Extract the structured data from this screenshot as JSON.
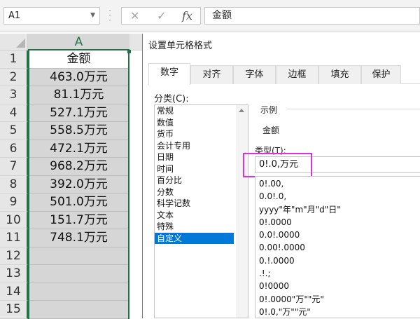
{
  "formula_bar": {
    "name_box": "A1",
    "cancel_icon": "✕",
    "enter_icon": "✓",
    "fx_label": "fx",
    "content": "金额"
  },
  "sheet": {
    "column_header": "A",
    "row_numbers": [
      "1",
      "2",
      "3",
      "4",
      "5",
      "6",
      "7",
      "8",
      "9",
      "10",
      "11",
      "12",
      "13",
      "14",
      "15"
    ],
    "cells": [
      "金额",
      "463.0万元",
      "81.1万元",
      "527.1万元",
      "558.5万元",
      "472.1万元",
      "968.2万元",
      "392.0万元",
      "501.0万元",
      "151.7万元",
      "748.1万元",
      "",
      "",
      "",
      ""
    ]
  },
  "dialog": {
    "title": "设置单元格格式",
    "tabs": [
      "数字",
      "对齐",
      "字体",
      "边框",
      "填充",
      "保护"
    ],
    "active_tab": "数字",
    "category_label": "分类(C):",
    "categories": [
      "常规",
      "数值",
      "货币",
      "会计专用",
      "日期",
      "时间",
      "百分比",
      "分数",
      "科学记数",
      "文本",
      "特殊",
      "自定义"
    ],
    "selected_category": "自定义",
    "example_label": "示例",
    "example_value": "金额",
    "type_label": "类型(T):",
    "type_value": "0!.0,万元",
    "format_list": [
      "0!.00,",
      "0.0!.0,",
      "yyyy\"年\"m\"月\"d\"日\"",
      "0!.0000",
      "0.0!.0000",
      "0.00!.0000",
      "0.!.0000",
      ".!.;",
      "0!0000",
      "0!.0000\"万\"\"元\"",
      "0!.0,\"万\"\"元\""
    ]
  },
  "colors": {
    "excel_green": "#217346",
    "selection_blue": "#0078d7",
    "highlight_magenta": "#d832d8"
  }
}
